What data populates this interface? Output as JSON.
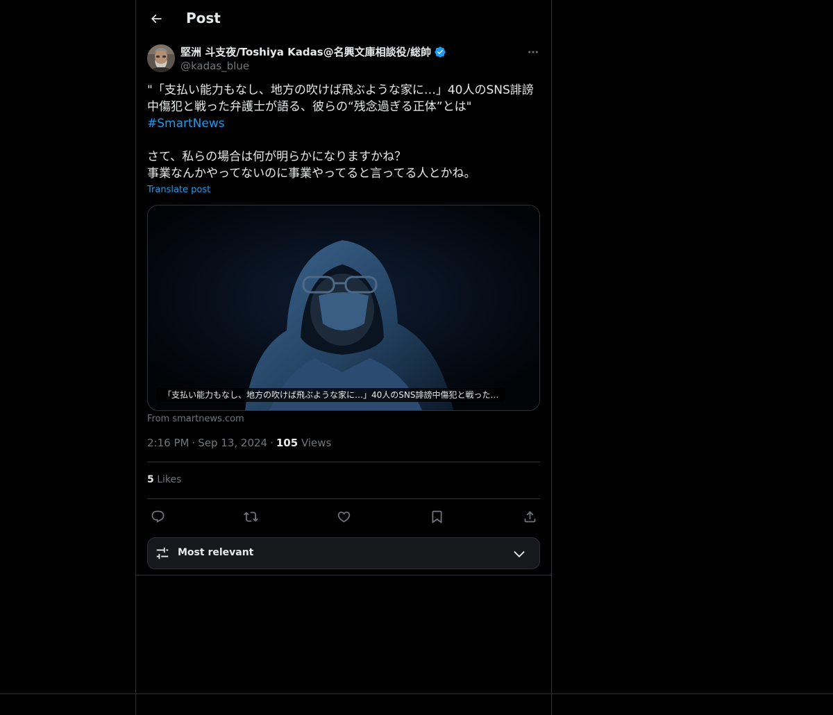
{
  "header": {
    "title": "Post"
  },
  "author": {
    "name": "堅洲 斗支夜/Toshiya Kadas@名興文庫相談役/総帥",
    "handle": "@kadas_blue",
    "verified": true
  },
  "post": {
    "line1": "\"「支払い能力もなし、地方の吹けば飛ぶような家に…」40人のSNS誹謗中傷犯と戦った弁護士が語る、彼らの“残念過ぎる正体”とは\"",
    "hashtag": "#SmartNews",
    "line2": "さて、私らの場合は何が明らかになりますかね？",
    "line3": "事業なんかやってないのに事業やってると言ってる人とかね。",
    "translate_label": "Translate post"
  },
  "card": {
    "caption": "「支払い能力もなし、地方の吹けば飛ぶような家に…」40人のSNS誹謗中傷犯と戦った…",
    "source": "From smartnews.com"
  },
  "meta": {
    "time": "2:16 PM",
    "date": "Sep 13, 2024",
    "views_count": "105",
    "views_label": "Views"
  },
  "stats": {
    "likes_count": "5",
    "likes_label": "Likes"
  },
  "actions": {
    "icons": [
      "reply-icon",
      "repost-icon",
      "like-icon",
      "bookmark-icon",
      "share-icon"
    ]
  },
  "sort": {
    "label": "Most relevant"
  },
  "colors": {
    "accent": "#1d9bf0",
    "background": "#000000",
    "border": "#2f3336",
    "muted_text": "#71767b",
    "text": "#e7e9ea"
  }
}
